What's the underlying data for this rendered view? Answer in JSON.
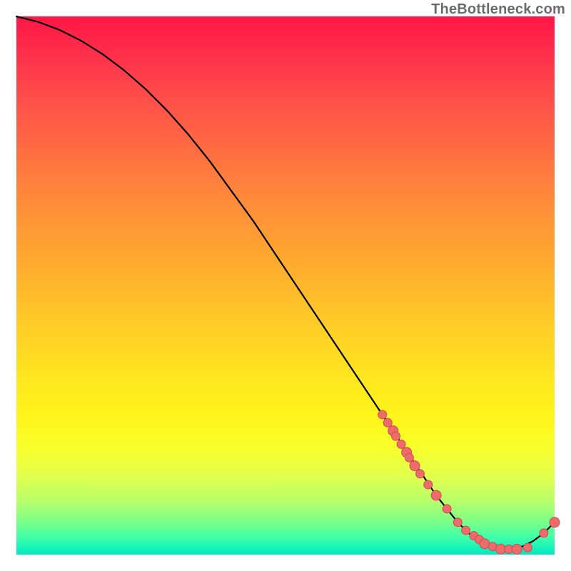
{
  "watermark": "TheBottleneck.com",
  "colors": {
    "curve": "#000000",
    "dot_fill": "#ef6a6a",
    "dot_stroke": "#c94f4f"
  },
  "chart_data": {
    "type": "line",
    "title": "",
    "xlabel": "",
    "ylabel": "",
    "xlim": [
      0,
      100
    ],
    "ylim": [
      0,
      100
    ],
    "grid": false,
    "legend": false,
    "series": [
      {
        "name": "bottleneck-curve",
        "x": [
          0,
          4,
          8,
          12,
          16,
          20,
          24,
          28,
          32,
          36,
          40,
          44,
          48,
          52,
          56,
          60,
          64,
          68,
          70,
          72,
          74,
          76,
          78,
          80,
          82,
          84,
          86,
          88,
          90,
          92,
          94,
          96,
          98,
          100
        ],
        "y": [
          100,
          99,
          97.5,
          95.5,
          93,
          90,
          86.5,
          82.5,
          78,
          73,
          67.5,
          62,
          56,
          50,
          44,
          38,
          32,
          26,
          23,
          20,
          17,
          14,
          11,
          8.5,
          6,
          4,
          2.5,
          1.5,
          1,
          1,
          1.5,
          2.5,
          4,
          6
        ]
      }
    ],
    "scatter_points": {
      "name": "highlighted-points",
      "x": [
        68,
        69,
        70,
        70.5,
        71.5,
        72.5,
        73,
        74,
        75,
        76.5,
        78,
        80,
        82,
        83.5,
        85,
        86,
        87,
        88.5,
        90,
        91.5,
        93,
        95,
        98,
        100
      ],
      "y": [
        26,
        24.5,
        23,
        22,
        20.5,
        19,
        18,
        16.5,
        15,
        13,
        11,
        8.5,
        6,
        4.5,
        3.5,
        2.8,
        2,
        1.5,
        1,
        1,
        1,
        1.3,
        4,
        6
      ],
      "r": [
        6,
        6,
        7,
        6,
        6,
        7,
        6,
        7,
        6,
        6,
        7,
        6,
        6,
        6,
        6,
        6,
        7,
        6,
        7,
        6,
        7,
        6,
        6,
        7
      ]
    }
  }
}
